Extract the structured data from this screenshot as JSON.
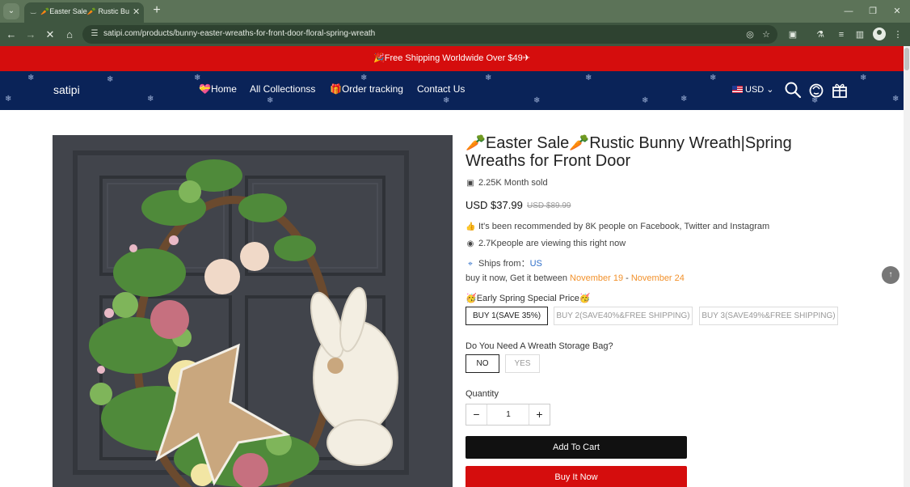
{
  "browser": {
    "tab_title": "🥕Easter Sale🥕 Rustic Bunny W",
    "new_tab": "+",
    "url": "satipi.com/products/bunny-easter-wreaths-for-front-door-floral-spring-wreath",
    "win_minimize": "—",
    "win_restore": "❐",
    "win_close": "✕"
  },
  "announcement": "🎉Free Shipping Worldwide Over $49✈",
  "header": {
    "logo": "satipi",
    "nav": [
      "💝Home",
      "All Collectionss",
      "🎁Order tracking",
      "Contact Us"
    ],
    "currency": "USD"
  },
  "product": {
    "title": "🥕Easter Sale🥕Rustic Bunny Wreath|Spring Wreaths for Front Door",
    "sold": "2.25K Month sold",
    "price": "USD $37.99",
    "compare_price": "USD $89.99",
    "recommended": "It's been recommended by 8K people on Facebook, Twitter and Instagram",
    "viewing": "2.7Kpeople are viewing this right now",
    "ships_from_label": "Ships from：",
    "ships_from_value": "US",
    "delivery_prefix": "buy it now,   Get it between ",
    "delivery_start": "November 19",
    "delivery_sep": " - ",
    "delivery_end": "November 24",
    "special_label": "🥳Early Spring Special Price🥳",
    "bundle_options": [
      "BUY 1(SAVE 35%)",
      "BUY 2(SAVE40%&FREE SHIPPING)",
      "BUY 3(SAVE49%&FREE SHIPPING)"
    ],
    "bag_label": "Do You Need A Wreath Storage Bag?",
    "bag_options": [
      "NO",
      "YES"
    ],
    "quantity_label": "Quantity",
    "quantity": "1",
    "add_to_cart": "Add To Cart",
    "buy_now": "Buy It Now"
  },
  "colors": {
    "announcement_bg": "#d50d0d",
    "header_bg": "#0a2358",
    "delivery_date": "#f2912b",
    "link": "#2f6fc9"
  }
}
